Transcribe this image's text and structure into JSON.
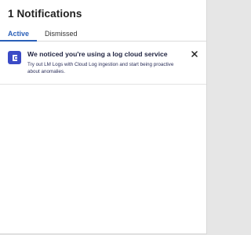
{
  "header": {
    "title": "1 Notifications"
  },
  "tabs": [
    {
      "label": "Active",
      "active": true
    },
    {
      "label": "Dismissed",
      "active": false
    }
  ],
  "notifications": [
    {
      "icon": "log-service-icon",
      "title": "We noticed you're using a log cloud service",
      "body": "Try out LM Logs with Cloud Log ingestion and start being proactive about anomalies.",
      "close_icon": "close-icon"
    }
  ],
  "colors": {
    "accent": "#2a5fb8",
    "icon_bg": "#3b4bc6"
  }
}
